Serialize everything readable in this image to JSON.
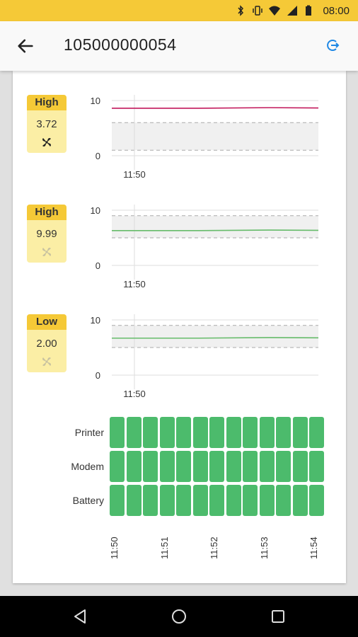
{
  "status_bar": {
    "time": "08:00",
    "icons": [
      "bluetooth-icon",
      "vibrate-icon",
      "wifi-icon",
      "lte-signal-icon",
      "battery-icon"
    ]
  },
  "app_bar": {
    "title": "105000000054",
    "back_icon": "arrow-left-icon",
    "action_icon": "refresh-icon",
    "accent": "#1e88e5"
  },
  "sensors": [
    {
      "level": "High",
      "value": "3.72",
      "fan_active": true,
      "chart": {
        "y_max_label": "10",
        "y_min_label": "0",
        "x_label": "11:50",
        "line_color": "#c2185b",
        "line_value": 8.6,
        "band": [
          1.0,
          6.0
        ]
      }
    },
    {
      "level": "High",
      "value": "9.99",
      "fan_active": false,
      "chart": {
        "y_max_label": "10",
        "y_min_label": "0",
        "x_label": "11:50",
        "line_color": "#66bb6a",
        "line_value": 6.3,
        "band": [
          5.0,
          9.0
        ]
      }
    },
    {
      "level": "Low",
      "value": "2.00",
      "fan_active": false,
      "chart": {
        "y_max_label": "10",
        "y_min_label": "0",
        "x_label": "11:50",
        "line_color": "#66bb6a",
        "line_value": 6.7,
        "band": [
          5.0,
          9.0
        ]
      }
    }
  ],
  "status_grid": {
    "rows": [
      "Printer",
      "Modem",
      "Battery"
    ],
    "columns": 13,
    "ok_color": "#4cbb6c",
    "x_ticks": [
      "11:50",
      "11:51",
      "11:52",
      "11:53",
      "11:54"
    ]
  },
  "nav_bar": {
    "buttons": [
      "back-triangle-icon",
      "home-circle-icon",
      "recents-square-icon"
    ]
  }
}
